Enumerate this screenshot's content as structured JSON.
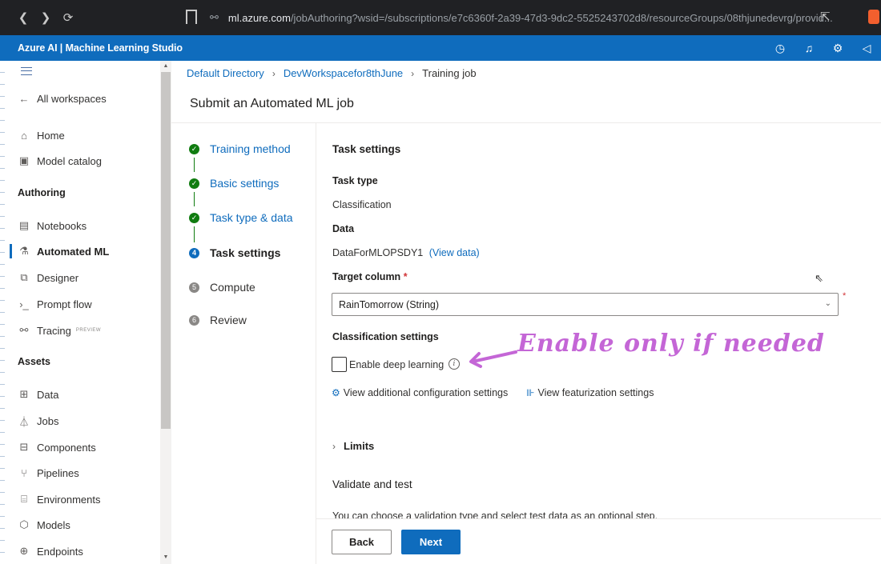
{
  "browser": {
    "back": "❮",
    "forward": "❯",
    "reload": "⟳",
    "url_host": "ml.azure.com",
    "url_path": "/jobAuthoring?wsid=/subscriptions/e7c6360f-2a39-47d3-9dc2-5525243702d8/resourceGroups/08thjunedevrg/provid..."
  },
  "header": {
    "title": "Azure AI | Machine Learning Studio"
  },
  "sidebar": {
    "all_workspaces": "All workspaces",
    "home": "Home",
    "model_catalog": "Model catalog",
    "authoring_heading": "Authoring",
    "notebooks": "Notebooks",
    "automated_ml": "Automated ML",
    "designer": "Designer",
    "prompt_flow": "Prompt flow",
    "tracing": "Tracing",
    "tracing_badge": "PREVIEW",
    "assets_heading": "Assets",
    "data": "Data",
    "jobs": "Jobs",
    "components": "Components",
    "pipelines": "Pipelines",
    "environments": "Environments",
    "models": "Models",
    "endpoints": "Endpoints"
  },
  "breadcrumb": {
    "item1": "Default Directory",
    "item2": "DevWorkspacefor8thJune",
    "current": "Training job"
  },
  "page": {
    "title": "Submit an Automated ML job"
  },
  "steps": {
    "s1": "Training method",
    "s2": "Basic settings",
    "s3": "Task type & data",
    "s4": "Task settings",
    "s4_num": "4",
    "s5": "Compute",
    "s5_num": "5",
    "s6": "Review",
    "s6_num": "6"
  },
  "form": {
    "section_title": "Task settings",
    "task_type_label": "Task type",
    "task_type_value": "Classification",
    "data_label": "Data",
    "data_value": "DataForMLOPSDY1",
    "view_data": "(View data)",
    "target_label": "Target column",
    "required_mark": "*",
    "target_value": "RainTomorrow (String)",
    "classification_settings": "Classification settings",
    "deep_learning_label": "Enable deep learning",
    "view_config": "View additional configuration settings",
    "view_featurization": "View featurization settings",
    "limits": "Limits",
    "validate_title": "Validate and test",
    "validate_hint": "You can choose a validation type and select test data as an optional step."
  },
  "annotation": {
    "text": "Enable only if needed",
    "color": "#c466d6"
  },
  "footer": {
    "back": "Back",
    "next": "Next"
  },
  "colors": {
    "azure_blue": "#0f6cbd",
    "success_green": "#107c10",
    "browser_dark": "#202124"
  }
}
